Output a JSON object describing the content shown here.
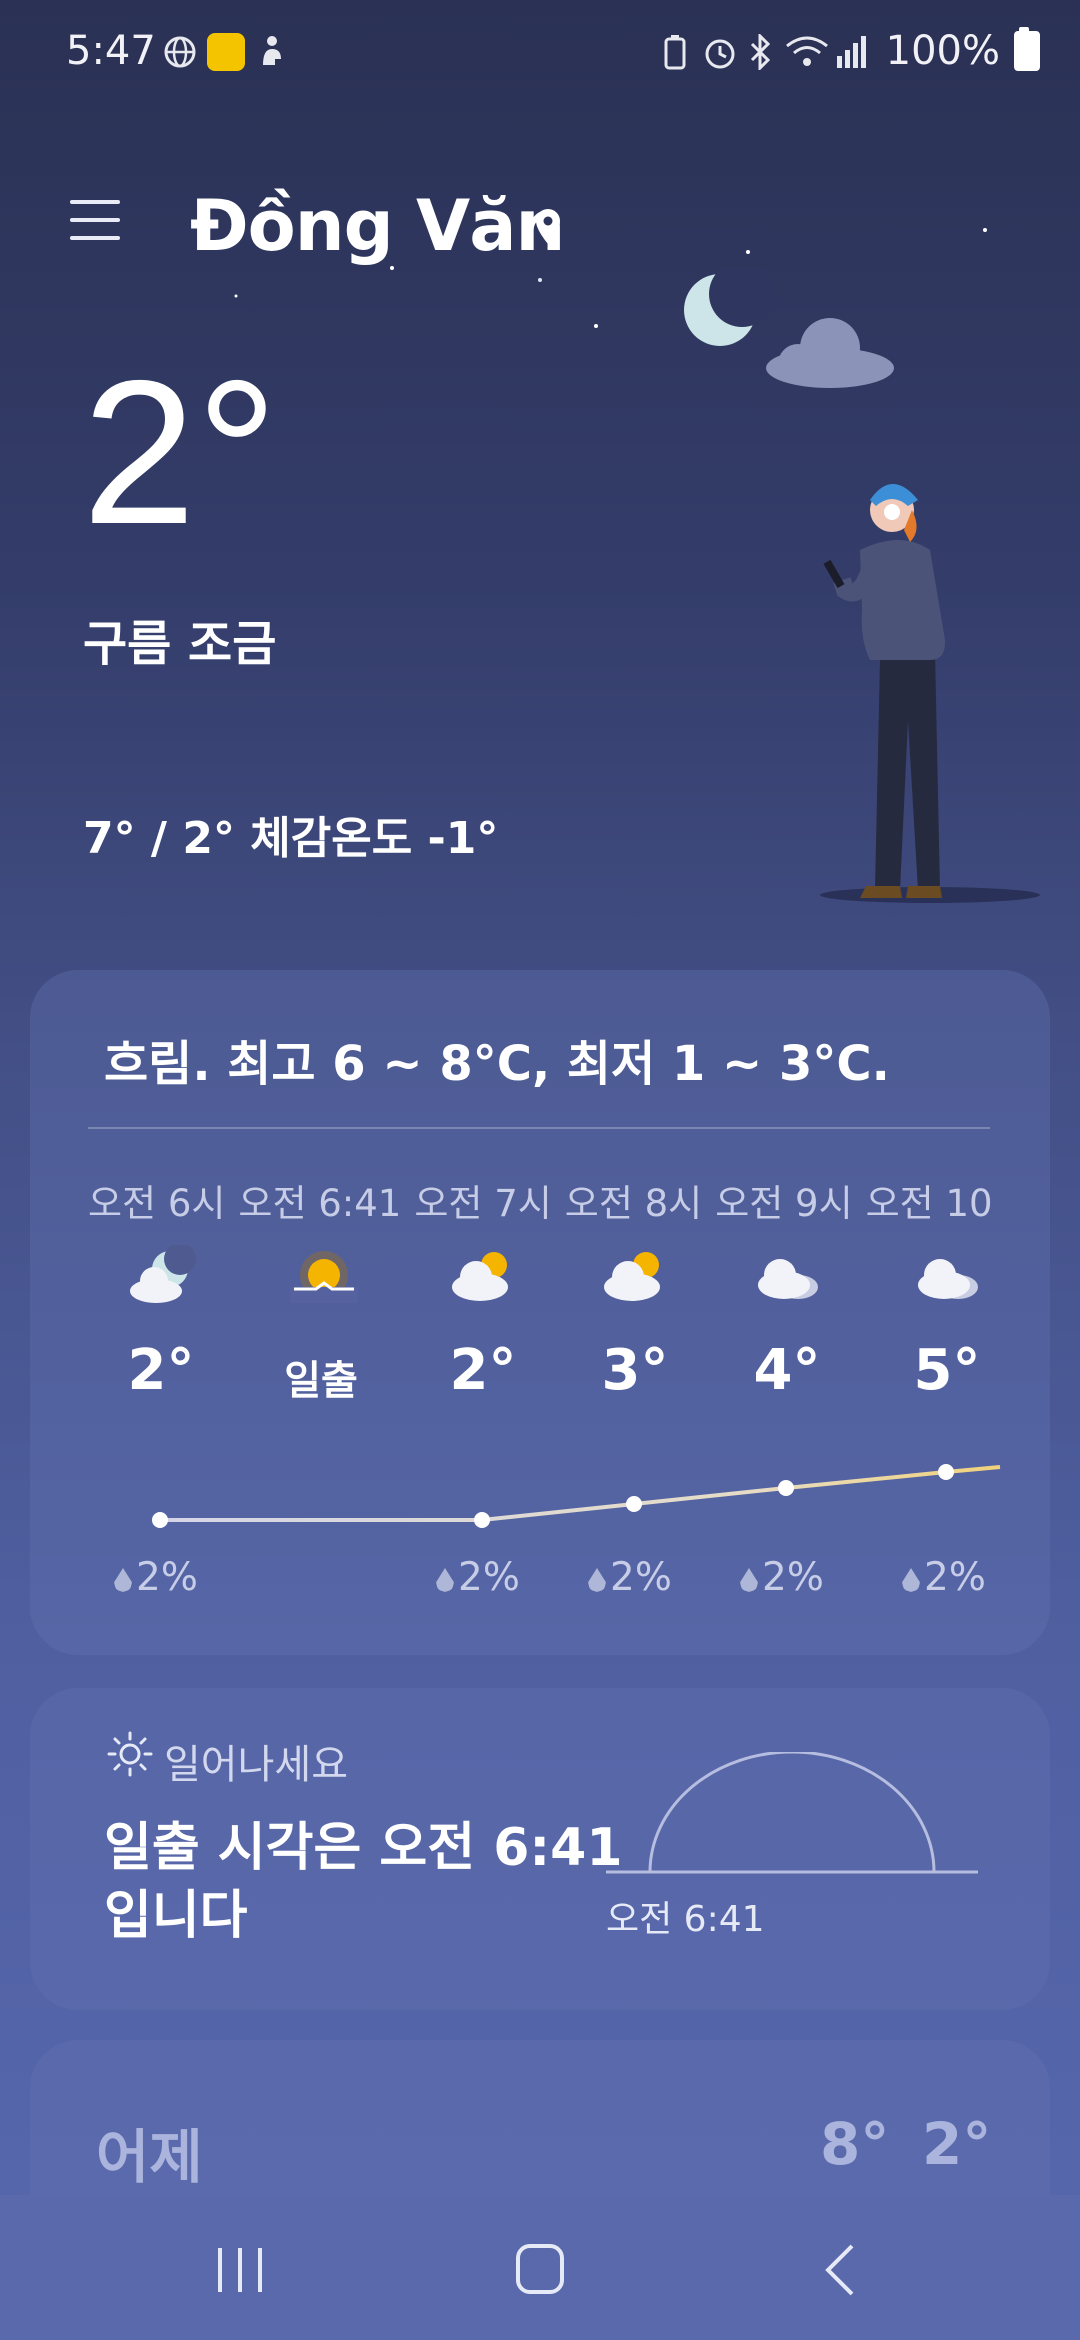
{
  "status_bar": {
    "time": "5:47",
    "battery": "100%",
    "icons": [
      "globe-icon",
      "app-badge-icon",
      "accessibility-icon",
      "battery-saver-icon",
      "alarm-icon",
      "bluetooth-icon",
      "wifi-icon",
      "signal-icon",
      "battery-icon"
    ]
  },
  "header": {
    "location": "Đồng Văn"
  },
  "current": {
    "temperature": "2°",
    "condition": "구름 조금",
    "hi_lo_feels": "7° / 2° 체감온도 -1°"
  },
  "hourly_card": {
    "summary": "흐림. 최고 6 ~ 8°C, 최저 1 ~ 3°C.",
    "hours": [
      {
        "time": "오전 6시",
        "value": "2°",
        "icon": "cloudy-night-icon",
        "rain": "2%"
      },
      {
        "time": "오전 6:41",
        "value": "일출",
        "icon": "sunrise-icon",
        "rain": ""
      },
      {
        "time": "오전 7시",
        "value": "2°",
        "icon": "partly-cloudy-icon",
        "rain": "2%"
      },
      {
        "time": "오전 8시",
        "value": "3°",
        "icon": "partly-cloudy-icon",
        "rain": "2%"
      },
      {
        "time": "오전 9시",
        "value": "4°",
        "icon": "cloudy-icon",
        "rain": "2%"
      },
      {
        "time": "오전 10",
        "value": "5°",
        "icon": "cloudy-icon",
        "rain": "2%"
      }
    ],
    "temps_numeric": [
      2,
      2,
      3,
      4,
      5
    ]
  },
  "sunrise_card": {
    "title": "일어나세요",
    "message": "일출 시각은 오전 6:41 입니다",
    "time": "오전 6:41"
  },
  "yesterday": {
    "label": "어제",
    "high": "8°",
    "low": "2°"
  },
  "colors": {
    "background_top": "#2a3154",
    "background_bottom": "#5868ae",
    "sun": "#f5b400",
    "card": "#5a68a8"
  }
}
